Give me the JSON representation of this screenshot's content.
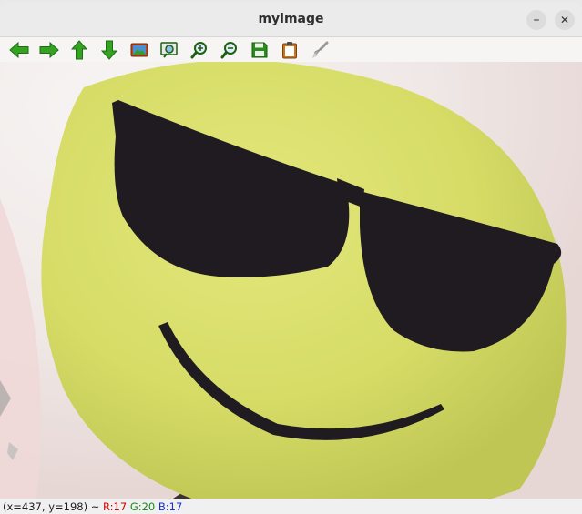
{
  "window": {
    "title": "myimage"
  },
  "titlebar_buttons": {
    "minimize_glyph": "–",
    "close_glyph": "✕"
  },
  "toolbar": {
    "items": [
      {
        "name": "pan-left-icon"
      },
      {
        "name": "pan-right-icon"
      },
      {
        "name": "pan-up-icon"
      },
      {
        "name": "pan-down-icon"
      },
      {
        "name": "zoom-original-icon"
      },
      {
        "name": "zoom-fit-icon"
      },
      {
        "name": "zoom-in-icon"
      },
      {
        "name": "zoom-out-icon"
      },
      {
        "name": "save-icon"
      },
      {
        "name": "copy-clipboard-icon"
      },
      {
        "name": "properties-brush-icon"
      }
    ]
  },
  "colors": {
    "arrow_green": "#2e9a1e",
    "emoji_yellow": "#d9df6a",
    "glasses": "#1e1b1f"
  },
  "status": {
    "coords": "(x=437, y=198) ~",
    "r": "R:17",
    "g": "G:20",
    "b": "B:17"
  }
}
